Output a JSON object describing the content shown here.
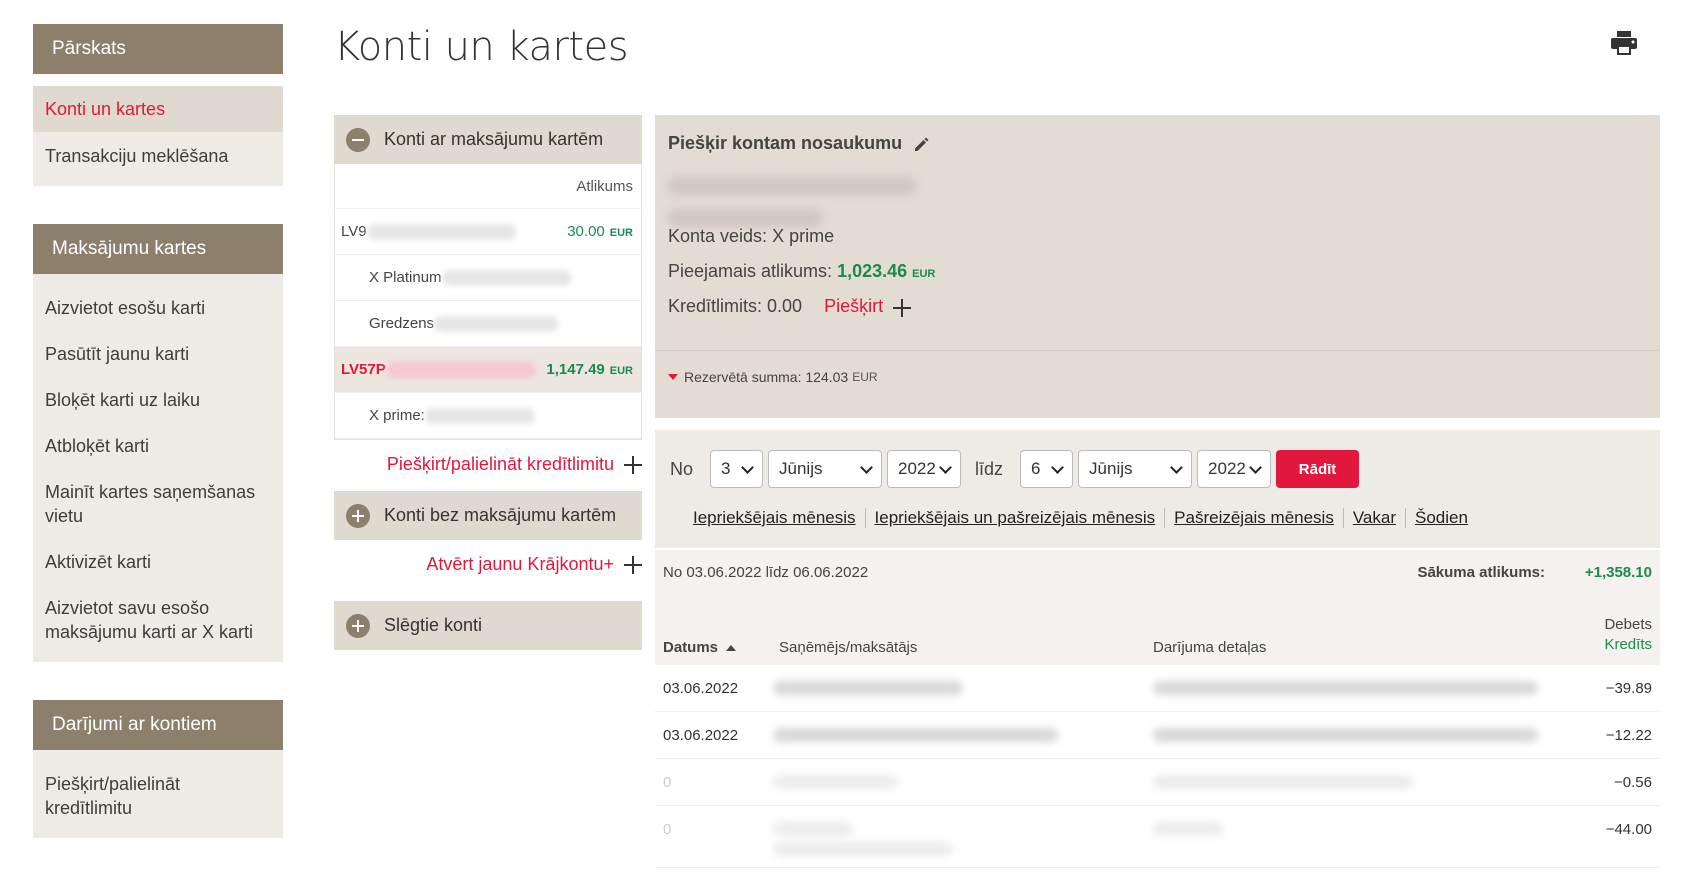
{
  "sidebar": {
    "sections": [
      {
        "title": "Pārskats",
        "items": [
          "Konti un kartes",
          "Transakciju meklēšana"
        ]
      },
      {
        "title": "Maksājumu kartes",
        "items": [
          "Aizvietot esošu karti",
          "Pasūtīt jaunu karti",
          "Bloķēt karti uz laiku",
          "Atbloķēt karti",
          "Mainīt kartes saņemšanas vietu",
          "Aktivizēt karti",
          "Aizvietot savu esošo maksājumu karti ar X karti"
        ]
      },
      {
        "title": "Darījumi ar kontiem",
        "items": [
          "Piešķirt/palielināt kredītlimitu"
        ]
      }
    ]
  },
  "page": {
    "title": "Konti un kartes"
  },
  "accounts": {
    "group_cards": "Konti ar maksājumu kartēm",
    "balance_header": "Atlikums",
    "rows": [
      {
        "label": "LV9",
        "amount": "30.00",
        "currency": "EUR"
      },
      {
        "label": "X Platinum",
        "sub": true
      },
      {
        "label": "Gredzens",
        "sub": true
      },
      {
        "label": "LV57P",
        "amount": "1,147.49",
        "currency": "EUR",
        "selected": true
      },
      {
        "label": "X prime:",
        "sub": true
      }
    ],
    "credit_link": "Piešķirt/palielināt kredītlimitu",
    "group_no_cards": "Konti bez maksājumu kartēm",
    "open_link": "Atvērt jaunu Krājkontu+",
    "group_closed": "Slēgtie konti"
  },
  "account_info": {
    "title": "Piešķir kontam nosaukumu",
    "type_label": "Konta veids: X prime",
    "available_label": "Pieejamais atlikums:",
    "available_value": "1,023.46",
    "available_currency": "EUR",
    "credit_label": "Kredītlimits: 0.00",
    "assign_link": "Piešķirt",
    "reserved_label": "Rezervētā summa: 124.03",
    "reserved_currency": "EUR"
  },
  "filter": {
    "from_label": "No",
    "from_day": "3",
    "from_month": "Jūnijs",
    "from_year": "2022",
    "to_label": "līdz",
    "to_day": "6",
    "to_month": "Jūnijs",
    "to_year": "2022",
    "show_button": "Rādīt",
    "quick_links": [
      "Iepriekšējais mēnesis",
      "Iepriekšējais un pašreizējais mēnesis",
      "Pašreizējais mēnesis",
      "Vakar",
      "Šodien"
    ]
  },
  "transactions": {
    "range_text": "No 03.06.2022 līdz 06.06.2022",
    "start_balance_label": "Sākuma atlikums:",
    "start_balance_value": "+1,358.10",
    "columns": {
      "date": "Datums",
      "payee": "Saņēmējs/maksātājs",
      "details": "Darījuma detaļas",
      "debit": "Debets",
      "credit": "Kredīts"
    },
    "rows": [
      {
        "date": "03.06.2022",
        "amount": "−39.89"
      },
      {
        "date": "03.06.2022",
        "amount": "−12.22"
      },
      {
        "date": "0",
        "amount": "−0.56"
      },
      {
        "date": "0",
        "amount": "−44.00"
      }
    ]
  },
  "colors": {
    "accent": "#e2173d",
    "brand": "#8c7f6b",
    "positive": "#1a8b4e"
  }
}
